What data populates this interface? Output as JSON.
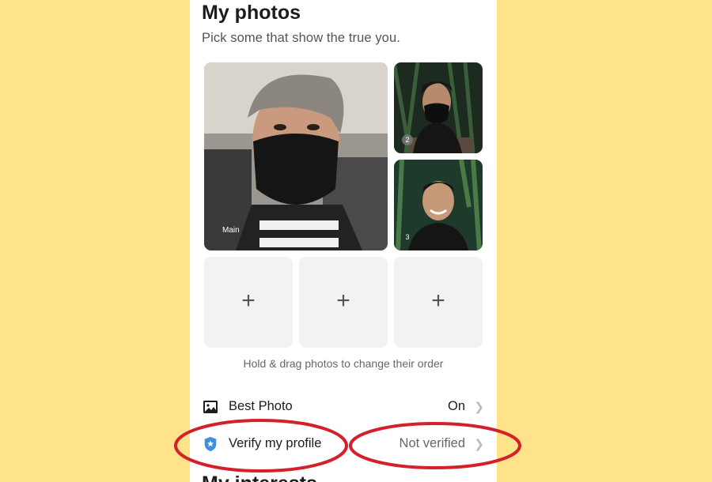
{
  "section": {
    "title": "My photos",
    "subtitle": "Pick some that show the true you.",
    "next_title": "My interests"
  },
  "photos": [
    {
      "label": "Main",
      "position": 1
    },
    {
      "label": "2",
      "position": 2
    },
    {
      "label": "3",
      "position": 3
    }
  ],
  "add_slots": [
    {
      "icon": "plus-icon",
      "symbol": "+"
    },
    {
      "icon": "plus-icon",
      "symbol": "+"
    },
    {
      "icon": "plus-icon",
      "symbol": "+"
    }
  ],
  "hint": "Hold & drag photos to change their order",
  "settings": [
    {
      "label": "Best Photo",
      "value": "On",
      "icon": "image-icon"
    },
    {
      "label": "Verify my profile",
      "value": "Not verified",
      "icon": "shield-star-icon"
    }
  ],
  "colors": {
    "background": "#FEE38A",
    "panel": "#FFFFFF",
    "annotation_circle": "#D4202A",
    "verify_icon": "#3D8FE0"
  }
}
